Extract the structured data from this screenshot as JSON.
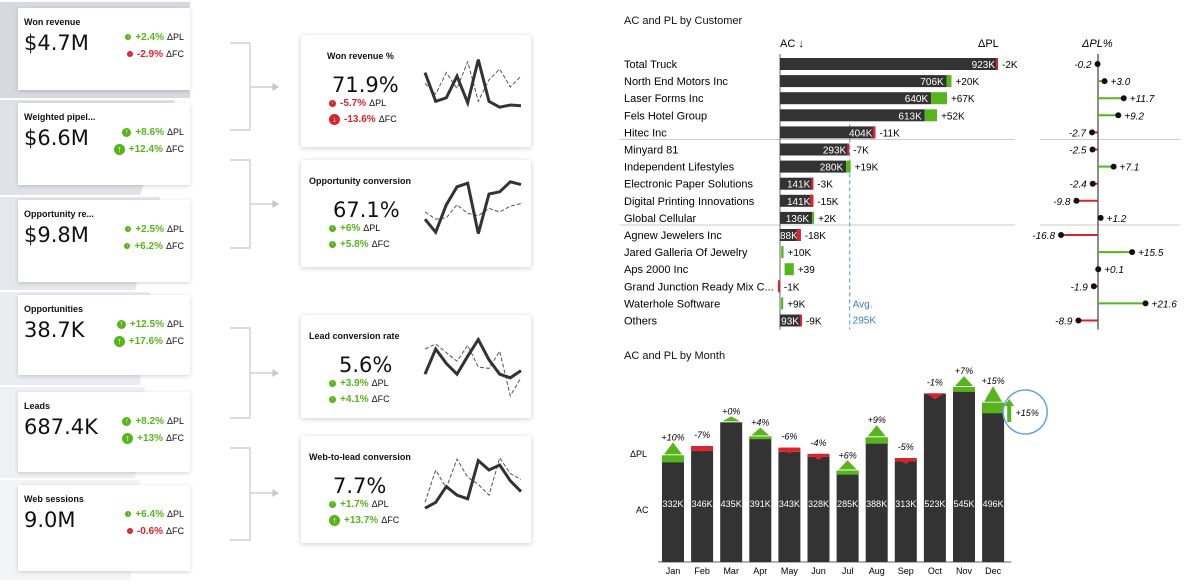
{
  "kpis": [
    {
      "title": "Won revenue",
      "value": "$4.7M",
      "d1": "+2.4%",
      "d1_dir": "pos",
      "d1_label": "ΔPL",
      "d2": "-2.9%",
      "d2_dir": "neg",
      "d2_label": "ΔFC"
    },
    {
      "title": "Weighted pipel...",
      "value": "$6.6M",
      "d1": "+8.6%",
      "d1_dir": "pos",
      "d1_label": "ΔPL",
      "d2": "+12.4%",
      "d2_dir": "pos",
      "d2_label": "ΔFC"
    },
    {
      "title": "Opportunity re...",
      "value": "$9.8M",
      "d1": "+2.5%",
      "d1_dir": "pos",
      "d1_label": "ΔPL",
      "d2": "+6.2%",
      "d2_dir": "pos",
      "d2_label": "ΔFC"
    },
    {
      "title": "Opportunities",
      "value": "38.7K",
      "d1": "+12.5%",
      "d1_dir": "pos",
      "d1_label": "ΔPL",
      "d2": "+17.6%",
      "d2_dir": "pos",
      "d2_label": "ΔFC"
    },
    {
      "title": "Leads",
      "value": "687.4K",
      "d1": "+8.2%",
      "d1_dir": "pos",
      "d1_label": "ΔPL",
      "d2": "+13%",
      "d2_dir": "pos",
      "d2_label": "ΔFC"
    },
    {
      "title": "Web sessions",
      "value": "9.0M",
      "d1": "+6.4%",
      "d1_dir": "pos",
      "d1_label": "ΔPL",
      "d2": "-0.6%",
      "d2_dir": "neg",
      "d2_label": "ΔFC"
    }
  ],
  "mid_cards": [
    {
      "title": "Won revenue %",
      "value": "71.9%",
      "d1": "-5.7%",
      "d1_dir": "neg",
      "d1_label": "ΔPL",
      "d2": "-13.6%",
      "d2_dir": "neg",
      "d2_label": "ΔFC",
      "spark_solid": [
        70,
        30,
        35,
        65,
        28,
        88,
        30,
        22,
        25,
        24
      ],
      "spark_dash": [
        55,
        40,
        70,
        48,
        85,
        30,
        60,
        75,
        50,
        65
      ]
    },
    {
      "title": "Opportunity conversion",
      "value": "67.1%",
      "d1": "+6%",
      "d1_dir": "pos",
      "d1_label": "ΔPL",
      "d2": "+5.8%",
      "d2_dir": "pos",
      "d2_label": "ΔFC",
      "spark_solid": [
        40,
        22,
        60,
        85,
        90,
        20,
        75,
        78,
        92,
        88
      ],
      "spark_dash": [
        50,
        40,
        42,
        60,
        48,
        45,
        55,
        50,
        58,
        62
      ]
    },
    {
      "title": "Lead conversion rate",
      "value": "5.6%",
      "d1": "+3.9%",
      "d1_dir": "pos",
      "d1_label": "ΔPL",
      "d2": "+4.1%",
      "d2_dir": "pos",
      "d2_label": "ΔFC",
      "spark_solid": [
        40,
        75,
        55,
        40,
        65,
        88,
        60,
        40,
        35,
        45
      ],
      "spark_dash": [
        75,
        82,
        70,
        58,
        80,
        50,
        48,
        72,
        10,
        35
      ]
    },
    {
      "title": "Web-to-lead conversion",
      "value": "7.7%",
      "d1": "+1.7%",
      "d1_dir": "pos",
      "d1_label": "ΔPL",
      "d2": "+13.7%",
      "d2_dir": "pos",
      "d2_label": "ΔFC",
      "spark_solid": [
        22,
        30,
        52,
        40,
        35,
        88,
        75,
        82,
        60,
        45
      ],
      "spark_dash": [
        30,
        75,
        50,
        90,
        65,
        55,
        40,
        92,
        70,
        62
      ]
    }
  ],
  "chart_data": [
    {
      "type": "bar",
      "title": "AC and PL by Customer",
      "columns": [
        "AC ↓",
        "ΔPL",
        "ΔPL%"
      ],
      "categories": [
        "Total Truck",
        "North End Motors Inc",
        "Laser Forms Inc",
        "Fels Hotel Group",
        "Hitec Inc",
        "Minyard 81",
        "Independent Lifestyles",
        "Electronic Paper Solutions",
        "Digital Printing Innovations",
        "Global Cellular",
        "Agnew Jewelers Inc",
        "Jared Galleria Of Jewelry",
        "Aps 2000 Inc",
        "Grand Junction Ready Mix C...",
        "Waterhole Software",
        "Others"
      ],
      "ac_values": [
        923,
        706,
        640,
        613,
        404,
        293,
        280,
        141,
        141,
        136,
        88,
        null,
        null,
        null,
        null,
        93
      ],
      "ac_labels": [
        "923K",
        "706K",
        "640K",
        "613K",
        "404K",
        "293K",
        "280K",
        "141K",
        "141K",
        "136K",
        "88K",
        "",
        "",
        "",
        "",
        "93K"
      ],
      "dpl_values": [
        -2,
        20,
        67,
        52,
        -11,
        -7,
        19,
        -3,
        -15,
        2,
        -18,
        10,
        39,
        -1,
        9,
        -9
      ],
      "dpl_labels": [
        "-2K",
        "+20K",
        "+67K",
        "+52K",
        "-11K",
        "-7K",
        "+19K",
        "-3K",
        "-15K",
        "+2K",
        "-18K",
        "+10K",
        "+39",
        "-1K",
        "+9K",
        "-9K"
      ],
      "dpl_pct": [
        -0.2,
        3.0,
        11.7,
        9.2,
        -2.7,
        -2.5,
        7.1,
        -2.4,
        -9.8,
        1.2,
        -16.8,
        15.5,
        0.1,
        -1.9,
        21.6,
        -8.9
      ],
      "dpl_pct_labels": [
        "-0.2",
        "+3.0",
        "+11.7",
        "+9.2",
        "-2.7",
        "-2.5",
        "+7.1",
        "-2.4",
        "-9.8",
        "+1.2",
        "-16.8",
        "+15.5",
        "+0.1",
        "-1.9",
        "+21.6",
        "-8.9"
      ],
      "avg_label": "Avg.",
      "avg_value": "295K",
      "pos_color": "#56b51a",
      "neg_color": "#d9232d",
      "bar_color": "#333333"
    },
    {
      "type": "bar",
      "title": "AC and PL by Month",
      "row_labels": [
        "ΔPL",
        "AC"
      ],
      "categories": [
        "Jan",
        "Feb",
        "Mar",
        "Apr",
        "May",
        "Jun",
        "Jul",
        "Aug",
        "Sep",
        "Oct",
        "Nov",
        "Dec"
      ],
      "ac_values": [
        332,
        346,
        435,
        391,
        343,
        328,
        285,
        388,
        313,
        523,
        545,
        496
      ],
      "ac_labels": [
        "332K",
        "346K",
        "435K",
        "391K",
        "343K",
        "328K",
        "285K",
        "388K",
        "313K",
        "523K",
        "545K",
        "496K"
      ],
      "dpl_pct": [
        10,
        -7,
        0,
        4,
        -6,
        -4,
        6,
        9,
        -5,
        -1,
        7,
        15
      ],
      "dpl_pct_labels": [
        "+10%",
        "-7%",
        "+0%",
        "+4%",
        "-6%",
        "-4%",
        "+6%",
        "+9%",
        "-5%",
        "-1%",
        "+7%",
        "+15%"
      ],
      "total_callout": "+15%"
    }
  ]
}
